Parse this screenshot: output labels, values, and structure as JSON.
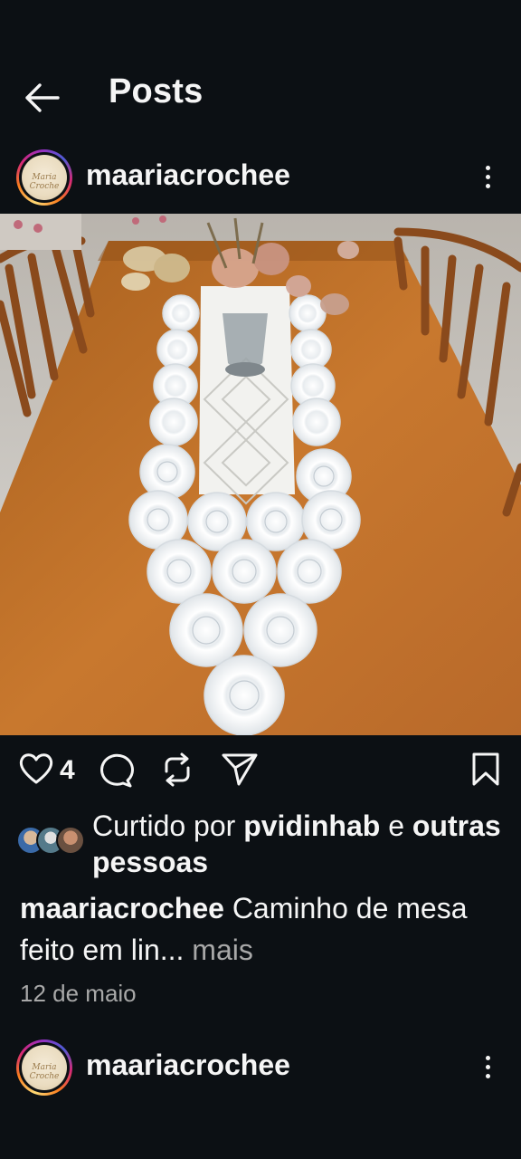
{
  "header": {
    "title": "Posts",
    "back_icon": "arrow-left-icon"
  },
  "post": {
    "username": "maariacrochee",
    "avatar_text": "Maria Croche",
    "image": {
      "description_icon": "photo"
    },
    "actions": {
      "like_count": "4",
      "icons": [
        "heart-icon",
        "comment-icon",
        "repost-icon",
        "share-icon",
        "bookmark-icon"
      ]
    },
    "liked_by": {
      "prefix": "Curtido por ",
      "user": "pvidinhab",
      "middle": " e ",
      "others": "outras pessoas"
    },
    "caption": {
      "username": "maariacrochee",
      "text": " Caminho de mesa feito em lin...",
      "more": " mais"
    },
    "date": "12 de maio"
  },
  "next_post": {
    "username": "maariacrochee",
    "avatar_text": "Maria Croche"
  },
  "colors": {
    "background": "#0c1014",
    "text": "#f5f5f5",
    "muted": "#a8a8a8",
    "table": "#c8782e"
  }
}
